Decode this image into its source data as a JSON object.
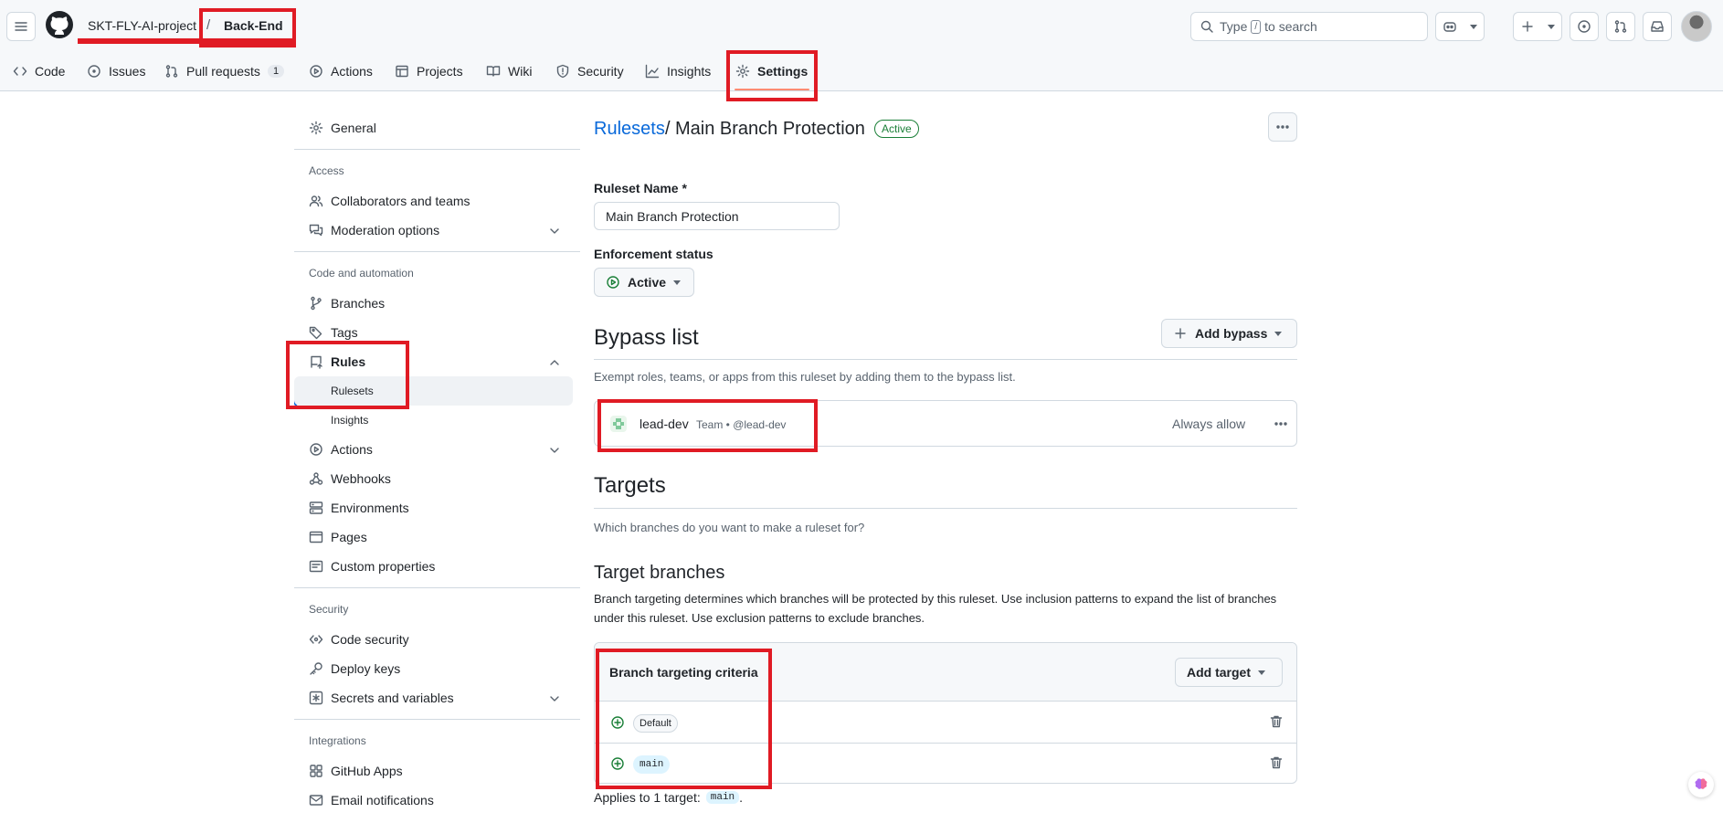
{
  "header": {
    "owner": "SKT-FLY-AI-project",
    "separator": "/",
    "repo": "Back-End",
    "search_prefix": "Type",
    "search_key": "/",
    "search_suffix": "to search"
  },
  "tabs": [
    {
      "label": "Code",
      "icon": "code-icon"
    },
    {
      "label": "Issues",
      "icon": "issue-opened-icon"
    },
    {
      "label": "Pull requests",
      "icon": "git-pull-request-icon",
      "count": "1"
    },
    {
      "label": "Actions",
      "icon": "play-icon"
    },
    {
      "label": "Projects",
      "icon": "table-icon"
    },
    {
      "label": "Wiki",
      "icon": "book-icon"
    },
    {
      "label": "Security",
      "icon": "shield-icon"
    },
    {
      "label": "Insights",
      "icon": "graph-icon"
    },
    {
      "label": "Settings",
      "icon": "gear-icon",
      "selected": true
    }
  ],
  "sidebar": {
    "general": "General",
    "access_heading": "Access",
    "collaborators": "Collaborators and teams",
    "moderation": "Moderation options",
    "code_heading": "Code and automation",
    "branches": "Branches",
    "tags": "Tags",
    "rules": "Rules",
    "rulesets": "Rulesets",
    "insights": "Insights",
    "actions": "Actions",
    "webhooks": "Webhooks",
    "environments": "Environments",
    "pages": "Pages",
    "custom_properties": "Custom properties",
    "security_heading": "Security",
    "code_security": "Code security",
    "deploy_keys": "Deploy keys",
    "secrets": "Secrets and variables",
    "integrations_heading": "Integrations",
    "github_apps": "GitHub Apps",
    "email_notifications": "Email notifications"
  },
  "main": {
    "breadcrumb_link": "Rulesets",
    "breadcrumb_sep": "/",
    "title": "Main Branch Protection",
    "status_badge": "Active",
    "ruleset_name_label": "Ruleset Name *",
    "ruleset_name_value": "Main Branch Protection",
    "enforcement_label": "Enforcement status",
    "enforcement_value": "Active",
    "bypass": {
      "heading": "Bypass list",
      "add_button": "Add bypass",
      "description": "Exempt roles, teams, or apps from this ruleset by adding them to the bypass list.",
      "entry_name": "lead-dev",
      "entry_meta": "Team • @lead-dev",
      "entry_mode": "Always allow"
    },
    "targets": {
      "heading": "Targets",
      "description": "Which branches do you want to make a ruleset for?",
      "branches_heading": "Target branches",
      "branches_desc": "Branch targeting determines which branches will be protected by this ruleset. Use inclusion patterns to expand the list of branches under this ruleset. Use exclusion patterns to exclude branches.",
      "criteria_title": "Branch targeting criteria",
      "add_target": "Add target",
      "criteria": [
        "Default",
        "main"
      ],
      "applies_prefix": "Applies to 1 target:",
      "applies_target": "main",
      "applies_suffix": "."
    }
  },
  "colors": {
    "accent": "#0969da",
    "success": "#1a7f37",
    "annotation": "#e01b24",
    "tab_underline": "#fd8c73"
  }
}
